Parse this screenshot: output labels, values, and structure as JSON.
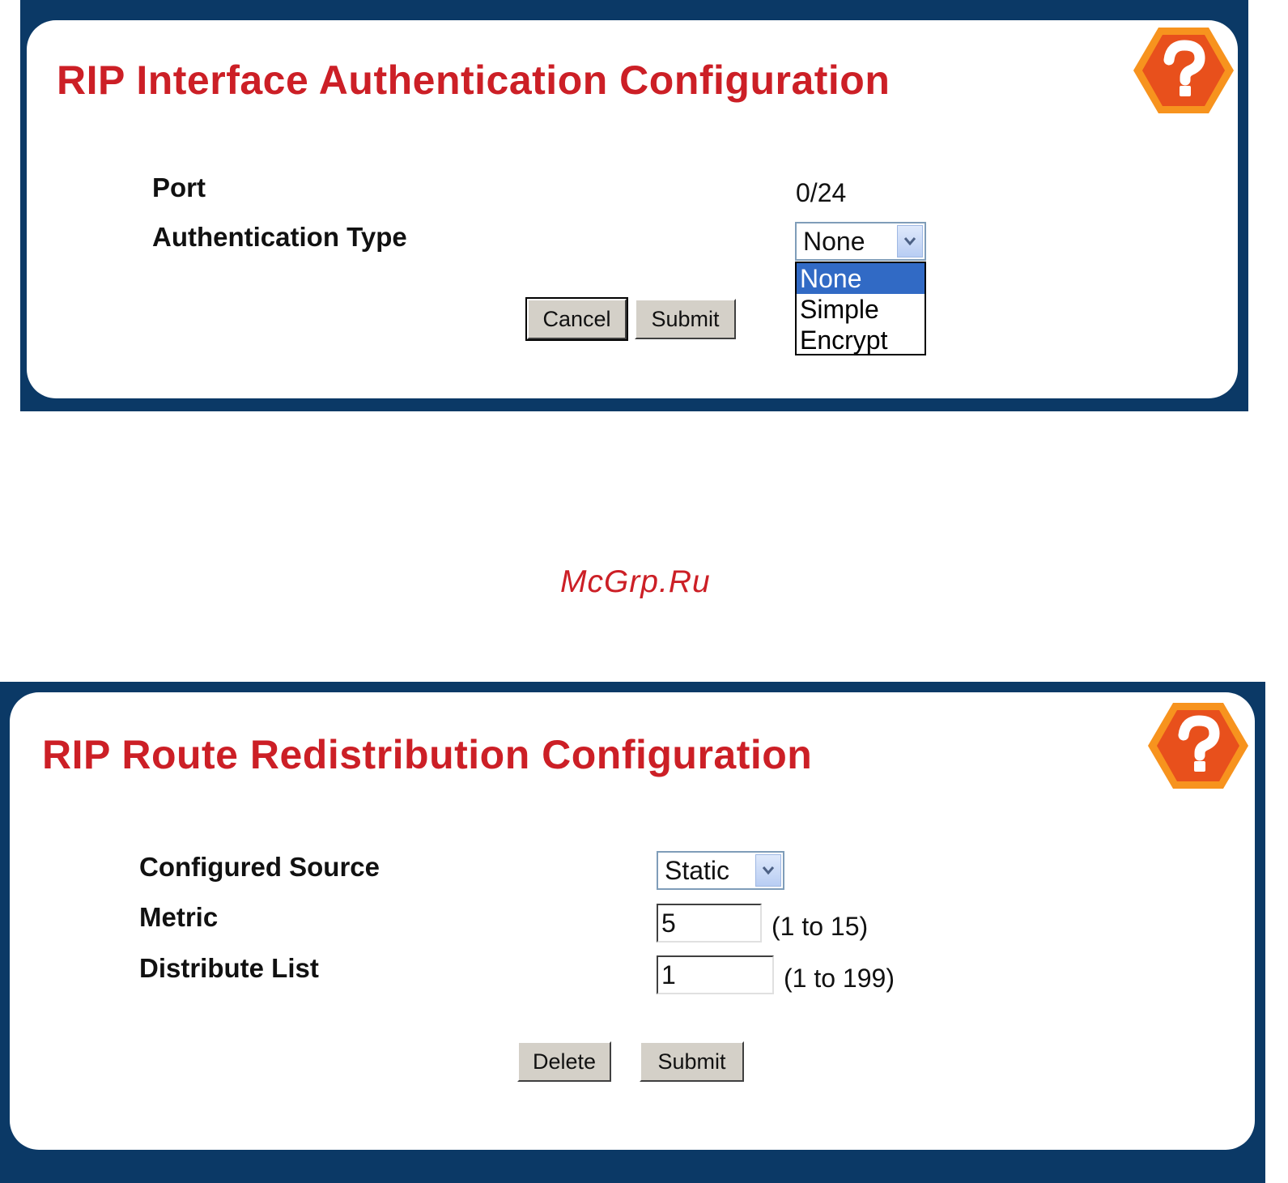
{
  "auth_panel": {
    "title": "RIP Interface Authentication Configuration",
    "help_icon": "help-question-icon",
    "port_label": "Port",
    "port_value": "0/24",
    "auth_type_label": "Authentication Type",
    "auth_type_selected": "None",
    "auth_type_options": [
      "None",
      "Simple",
      "Encrypt"
    ],
    "cancel_label": "Cancel",
    "submit_label": "Submit"
  },
  "watermark": "McGrp.Ru",
  "redist_panel": {
    "title": "RIP Route Redistribution Configuration",
    "help_icon": "help-question-icon",
    "source_label": "Configured Source",
    "source_selected": "Static",
    "metric_label": "Metric",
    "metric_value": "5",
    "metric_range": "(1 to 15)",
    "distribute_label": "Distribute List",
    "distribute_value": "1",
    "distribute_range": "(1 to 199)",
    "delete_label": "Delete",
    "submit_label": "Submit"
  },
  "colors": {
    "frame": "#0b3966",
    "title": "#cc1f26",
    "help_outer": "#f7931e",
    "help_inner": "#e8501c",
    "selected_option": "#316ac5"
  }
}
